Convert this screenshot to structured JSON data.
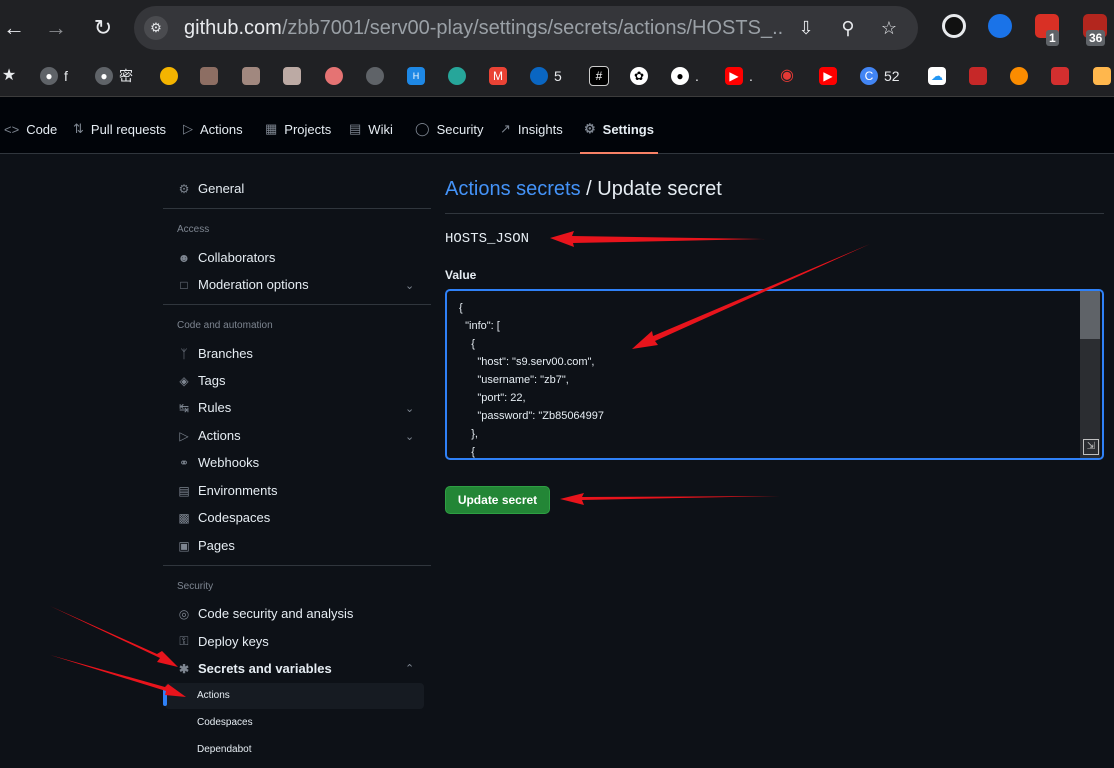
{
  "browser": {
    "url_host": "github.com",
    "url_path": "/zbb7001/serv00-play/settings/secrets/actions/HOSTS_...",
    "extensions": [
      {
        "icon": "opera-icon",
        "color": "#111111"
      },
      {
        "icon": "profile-icon",
        "color": "#1a73e8"
      },
      {
        "icon": "extension-red-icon",
        "color": "#d93025",
        "badge": "1"
      },
      {
        "icon": "extension-badge-icon",
        "color": "#b3261e",
        "badge": "36"
      }
    ]
  },
  "bookmarks": [
    {
      "icon": "star-icon",
      "label": ""
    },
    {
      "icon": "globe-icon",
      "label": "f"
    },
    {
      "icon": "globe-icon",
      "label": "密"
    },
    {
      "icon": "photos-icon",
      "label": ""
    },
    {
      "icon": "avatar-icon",
      "label": ""
    },
    {
      "icon": "avatar-icon",
      "label": ""
    },
    {
      "icon": "avatar-icon",
      "label": ""
    },
    {
      "icon": "ball-icon",
      "label": ""
    },
    {
      "icon": "globe-icon",
      "label": ""
    },
    {
      "icon": "hux-icon",
      "label": ""
    },
    {
      "icon": "spiral-icon",
      "label": ""
    },
    {
      "icon": "gmail-icon",
      "label": ""
    },
    {
      "icon": "onedrive-icon",
      "label": "5"
    },
    {
      "icon": "grid-icon",
      "label": ""
    },
    {
      "icon": "openai-icon",
      "label": ""
    },
    {
      "icon": "github-icon",
      "label": "."
    },
    {
      "icon": "youtube-icon",
      "label": "."
    },
    {
      "icon": "weibo-icon",
      "label": ""
    },
    {
      "icon": "youtube-icon",
      "label": ""
    },
    {
      "icon": "c-icon",
      "label": "52"
    },
    {
      "icon": "baidu-cloud-icon",
      "label": ""
    },
    {
      "icon": "stamp-icon",
      "label": ""
    },
    {
      "icon": "orange-icon",
      "label": ""
    },
    {
      "icon": "red-square-icon",
      "label": ""
    },
    {
      "icon": "hexagon-icon",
      "label": ""
    }
  ],
  "repo_tabs": [
    {
      "icon": "code-icon",
      "label": "Code"
    },
    {
      "icon": "pull-request-icon",
      "label": "Pull requests"
    },
    {
      "icon": "actions-icon",
      "label": "Actions"
    },
    {
      "icon": "projects-icon",
      "label": "Projects"
    },
    {
      "icon": "wiki-icon",
      "label": "Wiki"
    },
    {
      "icon": "security-icon",
      "label": "Security"
    },
    {
      "icon": "insights-icon",
      "label": "Insights"
    },
    {
      "icon": "settings-icon",
      "label": "Settings",
      "active": true
    }
  ],
  "sidebar": {
    "general": "General",
    "access_header": "Access",
    "access": [
      {
        "icon": "people-icon",
        "label": "Collaborators"
      },
      {
        "icon": "comment-icon",
        "label": "Moderation options",
        "expandable": true
      }
    ],
    "code_header": "Code and automation",
    "code": [
      {
        "icon": "branch-icon",
        "label": "Branches"
      },
      {
        "icon": "tag-icon",
        "label": "Tags"
      },
      {
        "icon": "rules-icon",
        "label": "Rules",
        "expandable": true
      },
      {
        "icon": "actions-icon",
        "label": "Actions",
        "expandable": true
      },
      {
        "icon": "webhook-icon",
        "label": "Webhooks"
      },
      {
        "icon": "server-icon",
        "label": "Environments"
      },
      {
        "icon": "codespaces-icon",
        "label": "Codespaces"
      },
      {
        "icon": "browser-icon",
        "label": "Pages"
      }
    ],
    "security_header": "Security",
    "security": [
      {
        "icon": "codescan-icon",
        "label": "Code security and analysis"
      },
      {
        "icon": "key-icon",
        "label": "Deploy keys"
      },
      {
        "icon": "asterisk-icon",
        "label": "Secrets and variables",
        "expanded": true
      }
    ],
    "secrets_sub": [
      "Actions",
      "Codespaces",
      "Dependabot"
    ]
  },
  "main": {
    "breadcrumb_link": "Actions secrets",
    "breadcrumb_sep": " / ",
    "heading": "Update secret",
    "secret_name": "HOSTS_JSON",
    "value_label": "Value",
    "value_text": "{\n  \"info\": [\n    {\n      \"host\": \"s9.serv00.com\",\n      \"username\": \"zb7\",\n      \"port\": 22,\n      \"password\": \"Zb85064997\n    },\n    {",
    "submit_label": "Update secret"
  },
  "colors": {
    "background": "#0d1117",
    "link": "#4493f8",
    "accent_tab": "#f78166",
    "button": "#238636",
    "annotation": "#e8141c"
  }
}
